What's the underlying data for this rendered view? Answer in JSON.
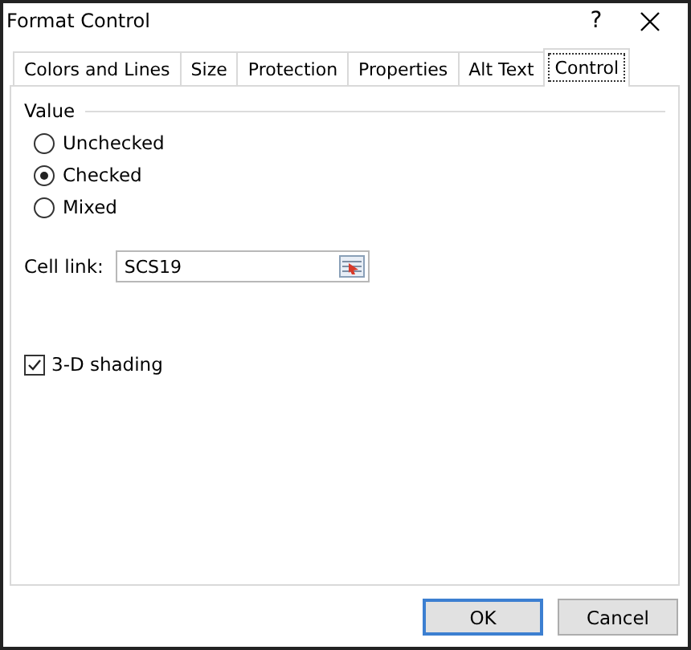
{
  "window": {
    "title": "Format Control",
    "help": "?"
  },
  "tabs": [
    {
      "label": "Colors and Lines",
      "selected": false
    },
    {
      "label": "Size",
      "selected": false
    },
    {
      "label": "Protection",
      "selected": false
    },
    {
      "label": "Properties",
      "selected": false
    },
    {
      "label": "Alt Text",
      "selected": false
    },
    {
      "label": "Control",
      "selected": true
    }
  ],
  "value_group": {
    "title": "Value",
    "options": [
      {
        "label": "Unchecked",
        "selected": false
      },
      {
        "label": "Checked",
        "selected": true
      },
      {
        "label": "Mixed",
        "selected": false
      }
    ]
  },
  "cell_link": {
    "label": "Cell link:",
    "value": "SCS19"
  },
  "shading": {
    "label": "3-D shading",
    "checked": true
  },
  "buttons": [
    {
      "label": "OK",
      "default": true
    },
    {
      "label": "Cancel",
      "default": false
    }
  ]
}
